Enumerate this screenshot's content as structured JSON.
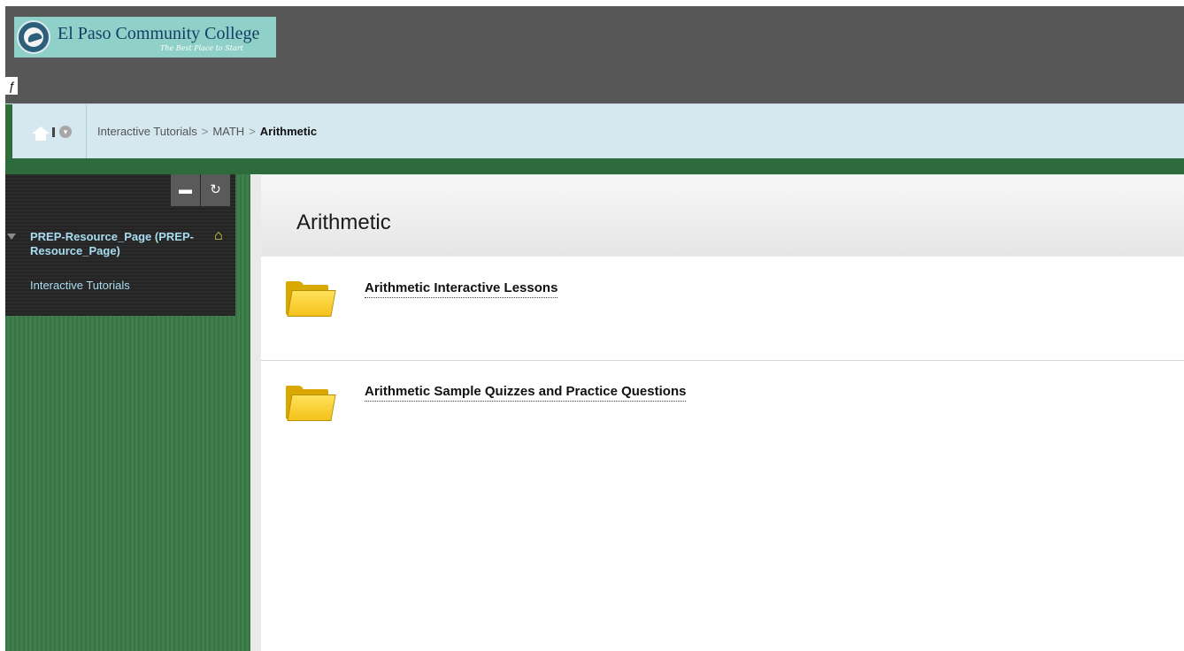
{
  "brand": {
    "name": "El Paso Community College",
    "tagline": "The Best Place to Start"
  },
  "breadcrumb": {
    "items": [
      "Interactive Tutorials",
      "MATH"
    ],
    "current": "Arithmetic",
    "separator": ">"
  },
  "course_menu": {
    "course_title": "PREP-Resource_Page (PREP-Resource_Page)",
    "items": [
      "Interactive Tutorials"
    ]
  },
  "content": {
    "title": "Arithmetic",
    "items": [
      {
        "label": "Arithmetic Interactive Lessons"
      },
      {
        "label": "Arithmetic Sample Quizzes and Practice Questions"
      }
    ]
  },
  "icons": {
    "home": "home-icon",
    "menu": "chevron-down-icon",
    "folder_tool": "folder-view-icon",
    "refresh": "refresh-icon",
    "course_home": "home-icon",
    "content_folder": "folder-icon"
  },
  "colors": {
    "header_bg": "#575757",
    "logo_bg": "#8fd1c8",
    "breadcrumb_bg": "#d5e7ef",
    "sidebar_green": "#3a7a47",
    "menu_dark": "#262626",
    "link_blue": "#a8dcf0",
    "folder_yellow": "#f4c21b"
  }
}
